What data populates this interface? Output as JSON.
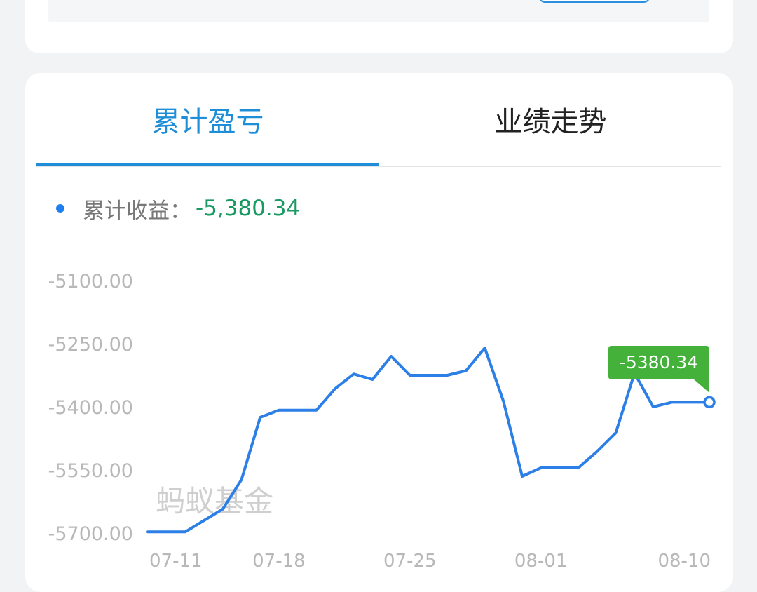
{
  "tabs": [
    {
      "label": "累计盈亏",
      "active": true
    },
    {
      "label": "业绩走势",
      "active": false
    }
  ],
  "legend": {
    "label": "累计收益：",
    "value": "-5,380.34"
  },
  "watermark": "蚂蚁基金",
  "tooltip": {
    "text": "-5380.34"
  },
  "colors": {
    "accent": "#1e8ed8",
    "line": "#2b7fe6",
    "positive_value": "#1a9a63",
    "tooltip_bg": "#43b13a"
  },
  "chart_data": {
    "type": "line",
    "x": [
      "07-11",
      "07-12",
      "07-13",
      "07-14",
      "07-15",
      "07-16",
      "07-17",
      "07-18",
      "07-19",
      "07-20",
      "07-21",
      "07-22",
      "07-23",
      "07-24",
      "07-25",
      "07-26",
      "07-27",
      "07-28",
      "07-29",
      "07-30",
      "07-31",
      "08-01",
      "08-02",
      "08-03",
      "08-04",
      "08-05",
      "08-06",
      "08-07",
      "08-08",
      "08-09",
      "08-10"
    ],
    "values": [
      -5697,
      -5697,
      -5697,
      -5670,
      -5643,
      -5573,
      -5425,
      -5408,
      -5408,
      -5408,
      -5357,
      -5322,
      -5335,
      -5280,
      -5325,
      -5325,
      -5325,
      -5314,
      -5260,
      -5387,
      -5565,
      -5545,
      -5545,
      -5545,
      -5506,
      -5462,
      -5320,
      -5400,
      -5389,
      -5389,
      -5389
    ],
    "yticks": [
      "-5100.00",
      "-5250.00",
      "-5400.00",
      "-5550.00",
      "-5700.00"
    ],
    "ytick_values": [
      -5100,
      -5250,
      -5400,
      -5550,
      -5700
    ],
    "xticks": [
      "07-11",
      "07-18",
      "07-25",
      "08-01",
      "08-10"
    ],
    "ylim": [
      -5700,
      -5100
    ],
    "last_value": -5380.34
  }
}
